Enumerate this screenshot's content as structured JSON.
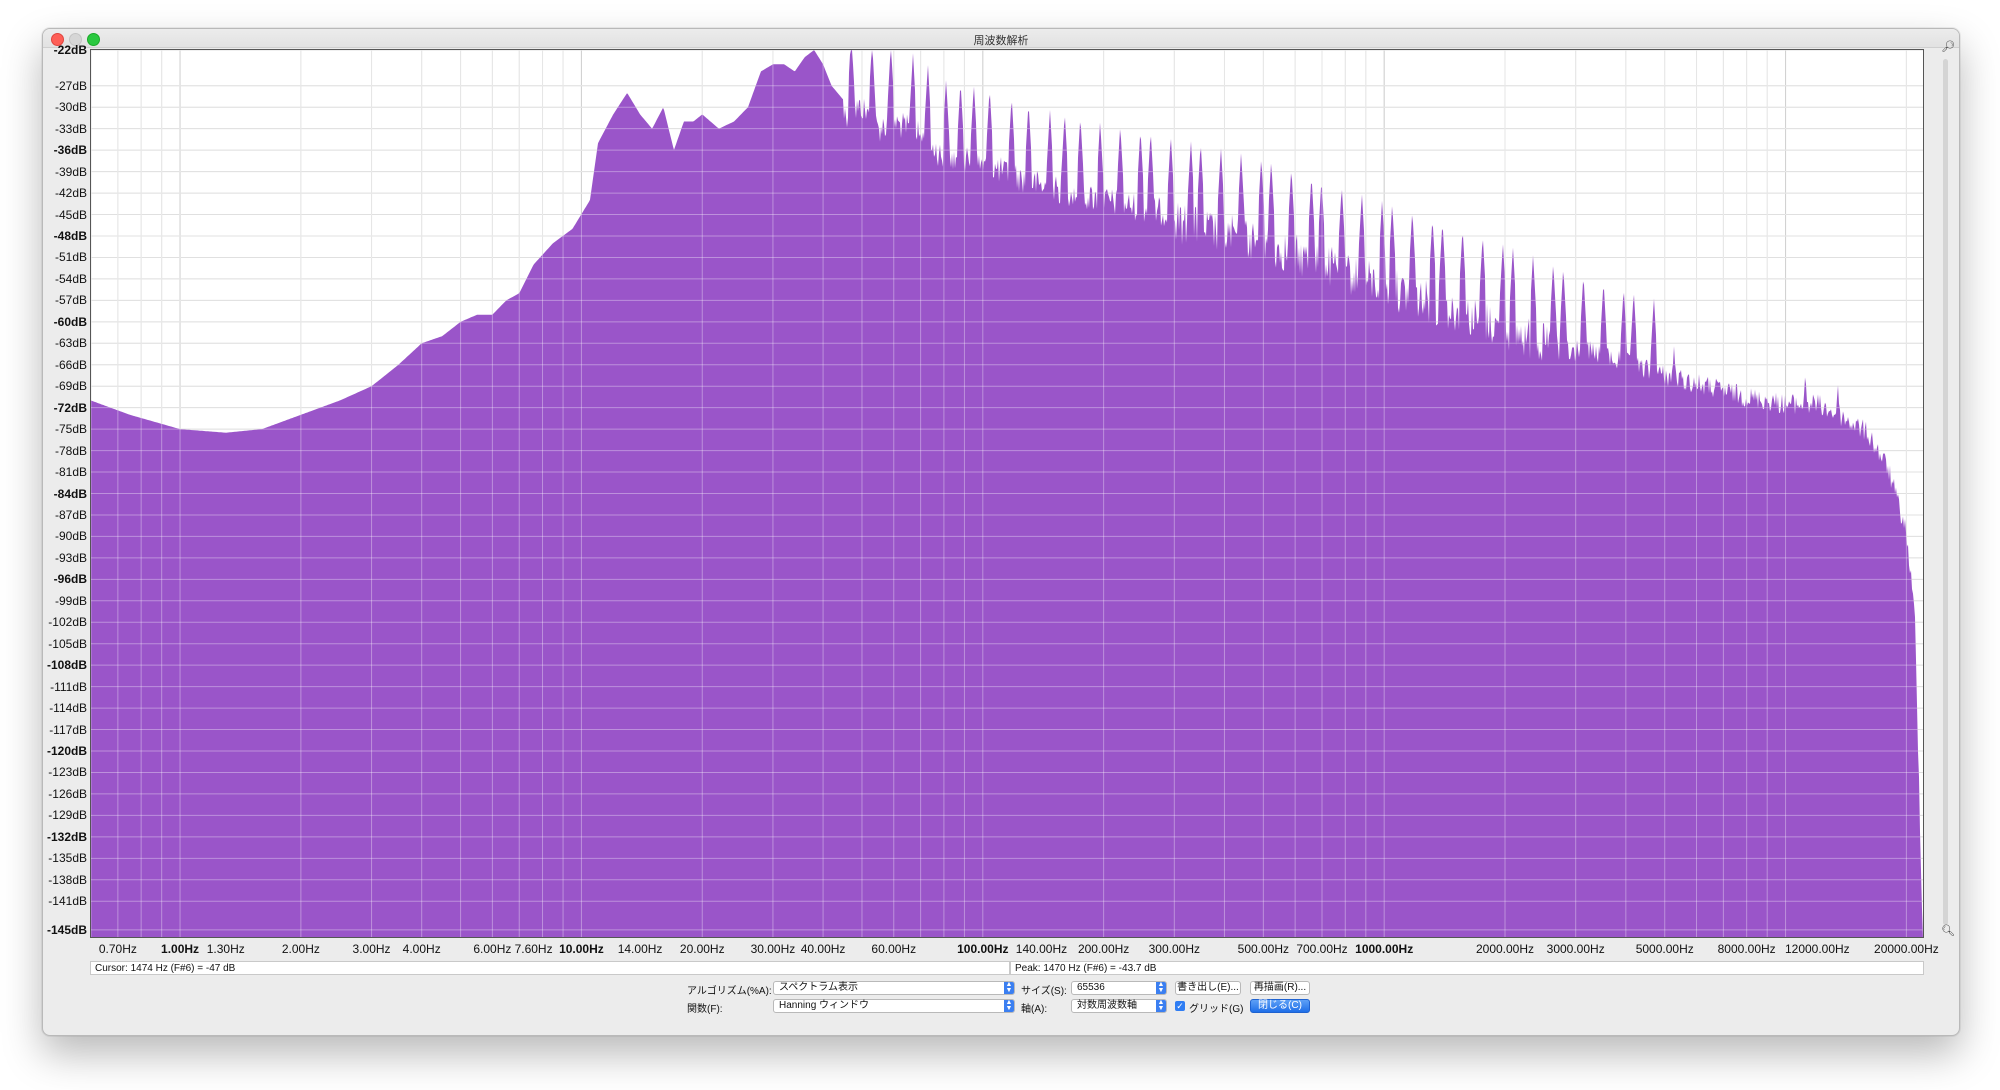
{
  "window": {
    "title": "周波数解析"
  },
  "colors": {
    "spectrum_fill": "#9a55c9",
    "grid": "#cfcfcf",
    "primary_button": "#2f7df3"
  },
  "chart_data": {
    "type": "area",
    "xscale": "log",
    "xlim": [
      0.6,
      22000
    ],
    "ylim": [
      -146,
      -22
    ],
    "grid": true,
    "x_ticks": [
      "0.70Hz",
      "1.00Hz",
      "1.30Hz",
      "2.00Hz",
      "3.00Hz",
      "4.00Hz",
      "6.00Hz",
      "7.60Hz",
      "10.00Hz",
      "14.00Hz",
      "20.00Hz",
      "30.00Hz",
      "40.00Hz",
      "60.00Hz",
      "100.00Hz",
      "140.00Hz",
      "200.00Hz",
      "300.00Hz",
      "500.00Hz",
      "700.00Hz",
      "1000.00Hz",
      "2000.00Hz",
      "3000.00Hz",
      "5000.00Hz",
      "8000.00Hz",
      "12000.00Hz",
      "20000.00Hz"
    ],
    "y_ticks": [
      "-22dB",
      "-27dB",
      "-30dB",
      "-33dB",
      "-36dB",
      "-39dB",
      "-42dB",
      "-45dB",
      "-48dB",
      "-51dB",
      "-54dB",
      "-57dB",
      "-60dB",
      "-63dB",
      "-66dB",
      "-69dB",
      "-72dB",
      "-75dB",
      "-78dB",
      "-81dB",
      "-84dB",
      "-87dB",
      "-90dB",
      "-93dB",
      "-96dB",
      "-99dB",
      "-102dB",
      "-105dB",
      "-108dB",
      "-111dB",
      "-114dB",
      "-117dB",
      "-120dB",
      "-123dB",
      "-126dB",
      "-129dB",
      "-132dB",
      "-135dB",
      "-138dB",
      "-141dB",
      "-145dB"
    ],
    "envelope": {
      "x": [
        0.6,
        0.75,
        1.0,
        1.3,
        1.6,
        2.0,
        2.5,
        3.0,
        3.5,
        4.0,
        4.5,
        5.0,
        5.5,
        6.0,
        6.5,
        7.0,
        7.6,
        8.5,
        9.5,
        10.5,
        11.0,
        12.0,
        13.0,
        14.0,
        15.0,
        16.0,
        17.0,
        18.0,
        19.0,
        20.0,
        22.0,
        24.0,
        26.0,
        28.0,
        30.0,
        32.0,
        34.0,
        36.0,
        38.0,
        40.0,
        42.0,
        45.0,
        50.0,
        55.0,
        60.0,
        70.0,
        80.0,
        100.0,
        140.0,
        200.0,
        300.0,
        500.0,
        700.0,
        1000.0,
        2000.0,
        3000.0,
        5000.0,
        8000.0,
        10000.0,
        12000.0,
        14000.0,
        16000.0,
        18000.0,
        20000.0,
        21000.0,
        22000.0
      ],
      "y": [
        -71,
        -73,
        -75,
        -75.5,
        -75,
        -73,
        -71,
        -69,
        -66,
        -63,
        -62,
        -60,
        -59,
        -59,
        -57,
        -56,
        -52,
        -49,
        -47,
        -43,
        -35,
        -31,
        -28,
        -31,
        -33,
        -30,
        -36,
        -32,
        -32,
        -31,
        -33,
        -32,
        -30,
        -25,
        -24,
        -24,
        -25,
        -23,
        -22,
        -24,
        -27,
        -29,
        -28,
        -31,
        -30,
        -32,
        -35,
        -36,
        -39,
        -41,
        -43,
        -46,
        -49,
        -52,
        -58,
        -62,
        -66,
        -69,
        -70,
        -70,
        -72,
        -74,
        -79,
        -88,
        -100,
        -145
      ]
    },
    "peaks_hz": [
      47,
      53,
      59,
      67,
      73,
      81,
      88,
      95,
      104,
      118,
      130,
      147,
      160,
      175,
      196,
      220,
      247,
      262,
      294,
      330,
      349,
      392,
      440,
      494,
      523,
      587,
      659,
      698,
      784,
      880,
      988,
      1047,
      1175,
      1319,
      1397,
      1568,
      1760,
      1976,
      2093,
      2349,
      2637,
      2794,
      3136,
      3520,
      3951,
      4186,
      4699,
      5274,
      11200,
      13500
    ]
  },
  "status": {
    "cursor_label": "Cursor:",
    "cursor_value": "1474 Hz (F#6) = -47 dB",
    "peak_label": "Peak:",
    "peak_value": "1470 Hz (F#6) = -43.7 dB"
  },
  "controls": {
    "algorithm_label": "アルゴリズム(%A):",
    "algorithm_value": "スペクトラム表示",
    "size_label": "サイズ(S):",
    "size_value": "65536",
    "export_button": "書き出し(E)...",
    "replot_button": "再描画(R)...",
    "function_label": "関数(F):",
    "function_value": "Hanning ウィンドウ",
    "axis_label": "軸(A):",
    "axis_value": "対数周波数軸",
    "grid_label": "グリッド(G)",
    "grid_checked": true,
    "close_button": "閉じる(C)"
  }
}
